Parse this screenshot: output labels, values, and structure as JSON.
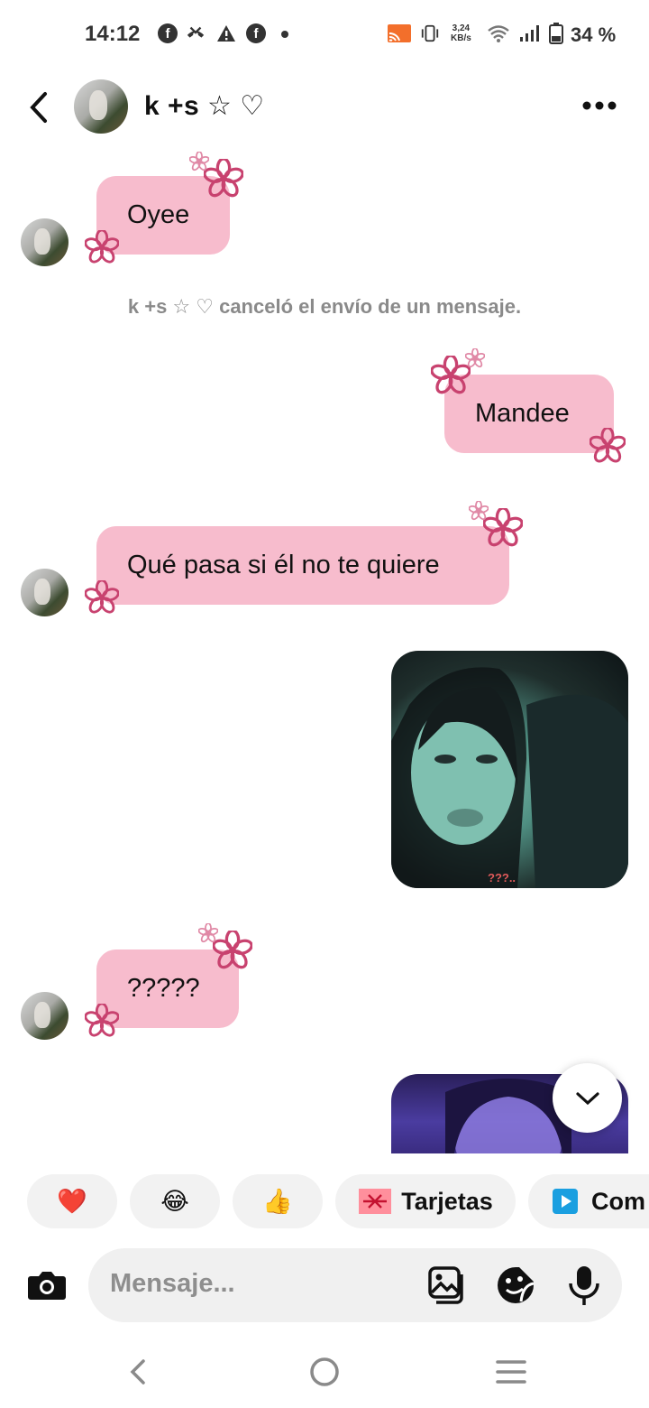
{
  "status_bar": {
    "time": "14:12",
    "speed_value": "3,24",
    "speed_unit": "KB/s",
    "battery": "34 %"
  },
  "header": {
    "contact_name": "k +s ☆ ♡"
  },
  "messages": [
    {
      "text": "Oyee"
    },
    {
      "system": "k +s ☆ ♡ canceló el envío de un mensaje."
    },
    {
      "text": "Mandee"
    },
    {
      "text": "Qué pasa si él no te quiere"
    },
    {
      "photo_caption": "???.."
    },
    {
      "text": "?????"
    }
  ],
  "quick_replies": [
    {
      "emoji": "❤️"
    },
    {
      "emoji": "😂"
    },
    {
      "emoji": "👍"
    },
    {
      "label": "Tarjetas"
    },
    {
      "label": "Com"
    }
  ],
  "composer": {
    "placeholder": "Mensaje..."
  },
  "colors": {
    "bubble": "#f7bccd",
    "flower": "#c8426f",
    "background": "#ffffff"
  }
}
